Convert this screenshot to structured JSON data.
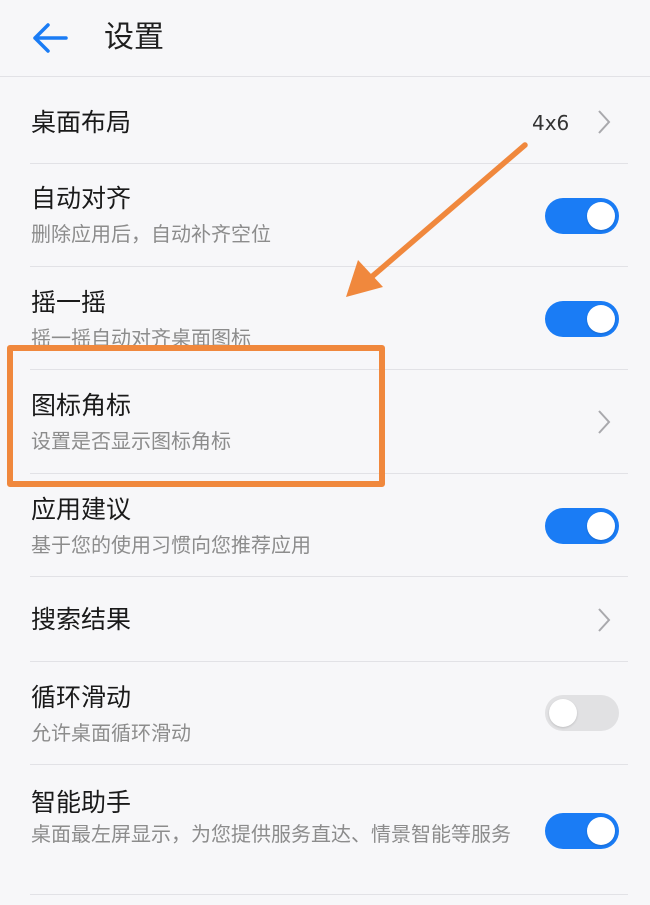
{
  "header": {
    "title": "设置"
  },
  "settings": {
    "desktop_layout": {
      "label": "桌面布局",
      "value": "4x6"
    },
    "auto_align": {
      "label": "自动对齐",
      "sub": "删除应用后，自动补齐空位",
      "enabled": true
    },
    "shake": {
      "label": "摇一摇",
      "sub": "摇一摇自动对齐桌面图标",
      "enabled": true
    },
    "icon_badge": {
      "label": "图标角标",
      "sub": "设置是否显示图标角标"
    },
    "app_suggest": {
      "label": "应用建议",
      "sub": "基于您的使用习惯向您推荐应用",
      "enabled": true
    },
    "search_results": {
      "label": "搜索结果"
    },
    "loop_scroll": {
      "label": "循环滑动",
      "sub": "允许桌面循环滑动",
      "enabled": false
    },
    "assistant": {
      "label": "智能助手",
      "sub": "桌面最左屏显示，为您提供服务直达、情景智能等服务",
      "enabled": true
    }
  },
  "colors": {
    "accent": "#1a7cf5",
    "annotation": "#f0883d",
    "toggle_off": "#e1e1e3"
  },
  "icons": {
    "back": "back-arrow-icon",
    "chevron": "chevron-right-icon"
  }
}
